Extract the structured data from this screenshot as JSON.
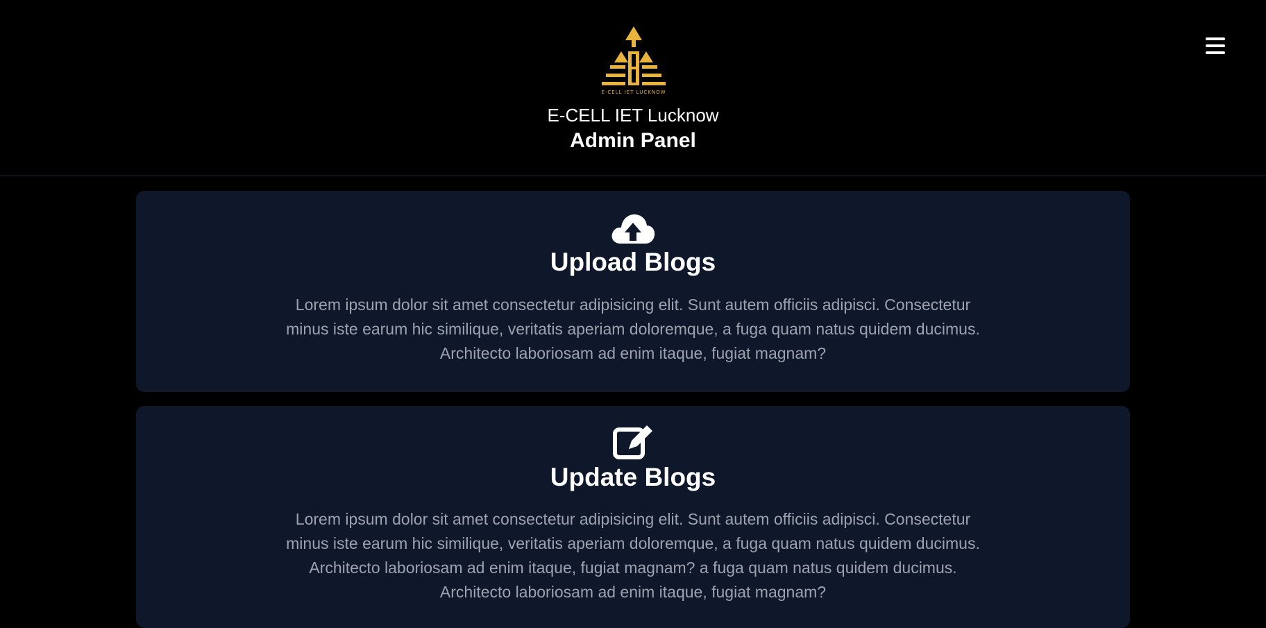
{
  "header": {
    "logo_icon": "ecell-pyramid-logo-icon",
    "logo_caption": "E-CELL IET LUCKNOW",
    "org_name": "E-CELL IET Lucknow",
    "panel_title": "Admin Panel",
    "menu_icon": "hamburger-menu-icon"
  },
  "cards": [
    {
      "icon": "cloud-upload-icon",
      "title": "Upload Blogs",
      "description": "Lorem ipsum dolor sit amet consectetur adipisicing elit. Sunt autem officiis adipisci. Consectetur minus iste earum hic similique, veritatis aperiam doloremque, a fuga quam natus quidem ducimus. Architecto laboriosam ad enim itaque, fugiat magnam?"
    },
    {
      "icon": "edit-square-icon",
      "title": "Update Blogs",
      "description": "Lorem ipsum dolor sit amet consectetur adipisicing elit. Sunt autem officiis adipisci. Consectetur minus iste earum hic similique, veritatis aperiam doloremque, a fuga quam natus quidem ducimus. Architecto laboriosam ad enim itaque, fugiat magnam? a fuga quam natus quidem ducimus. Architecto laboriosam ad enim itaque, fugiat magnam?"
    }
  ],
  "colors": {
    "background": "#000000",
    "card_background": "#0f172a",
    "logo_gold": "#e8b43c",
    "text_primary": "#ffffff",
    "text_muted": "#9ca3af"
  }
}
